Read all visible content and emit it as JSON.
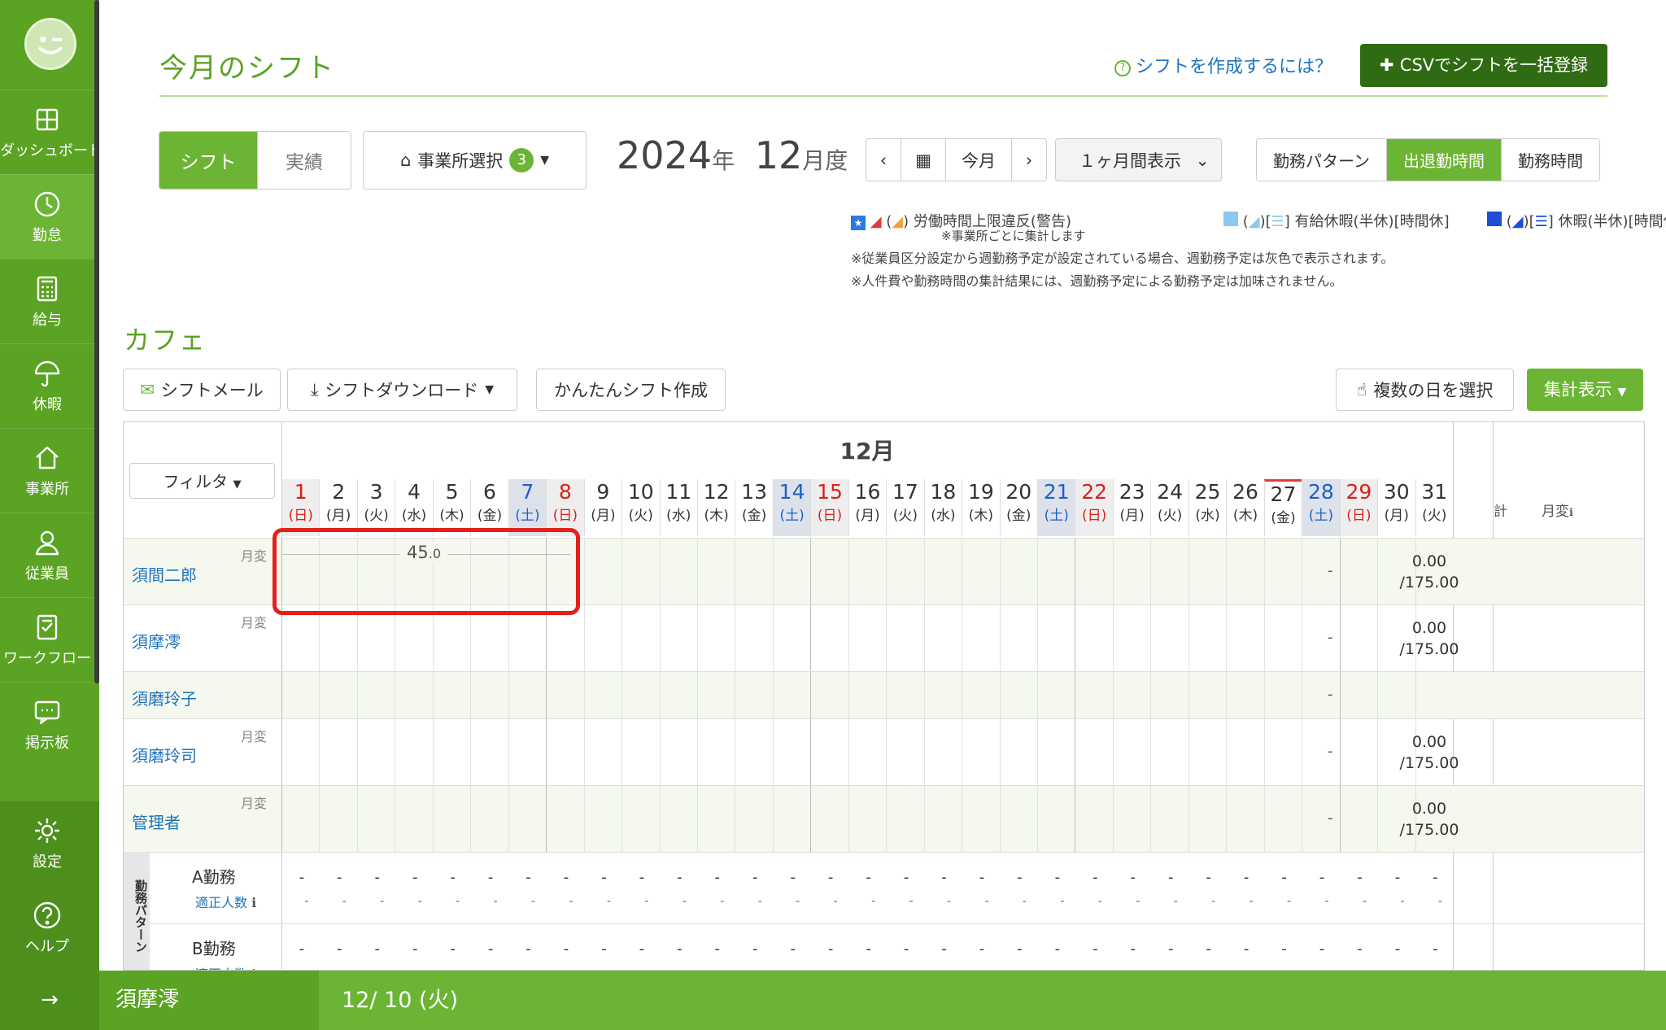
{
  "sidebar": {
    "items": [
      {
        "label": "ダッシュボード",
        "icon": "dashboard-icon"
      },
      {
        "label": "勤怠",
        "icon": "clock-icon",
        "active": true
      },
      {
        "label": "給与",
        "icon": "calculator-icon"
      },
      {
        "label": "休暇",
        "icon": "umbrella-icon"
      },
      {
        "label": "事業所",
        "icon": "home-icon"
      },
      {
        "label": "従業員",
        "icon": "person-icon"
      },
      {
        "label": "ワークフロー",
        "icon": "workflow-icon"
      },
      {
        "label": "掲示板",
        "icon": "chat-icon"
      }
    ],
    "bottom": [
      {
        "label": "設定",
        "icon": "gear-icon"
      },
      {
        "label": "ヘルプ",
        "icon": "help-icon"
      }
    ],
    "collapse": "→"
  },
  "header": {
    "title": "今月のシフト",
    "help_link": "シフトを作成するには？",
    "csv_button": "CSVでシフトを一括登録"
  },
  "toolbar": {
    "mode_shift": "シフト",
    "mode_actual": "実績",
    "office_select": "事業所選択",
    "office_count": "3",
    "year": "2024",
    "year_unit": "年",
    "month": "12",
    "month_unit": "月度",
    "today": "今月",
    "period": "１ヶ月間表示",
    "view_pattern": "勤務パターン",
    "view_inout": "出退勤時間",
    "view_hours": "勤務時間"
  },
  "legend": {
    "warn": "労働時間上限違反(警告)",
    "warn_sub": "※事業所ごとに集計します",
    "paid": "有給休暇(半休)[時間休]",
    "leave": "休暇(半休)[時間休]",
    "note1": "※従業員区分設定から週勤務予定が設定されている場合、週勤務予定は灰色で表示されます。",
    "note2": "※人件費や勤務時間の集計結果には、週勤務予定による勤務予定は加味されません。"
  },
  "section": {
    "title": "カフェ",
    "mail_btn": "シフトメール",
    "download_btn": "シフトダウンロード",
    "easy_btn": "かんたんシフト作成",
    "multi_btn": "複数の日を選択",
    "summary_btn": "集計表示"
  },
  "grid": {
    "month_label": "12月",
    "filter": "フィルタ",
    "total_header": "計",
    "monthly_header": "月変",
    "days": [
      {
        "n": "1",
        "w": "(日)",
        "t": "sun"
      },
      {
        "n": "2",
        "w": "(月)"
      },
      {
        "n": "3",
        "w": "(火)"
      },
      {
        "n": "4",
        "w": "(水)"
      },
      {
        "n": "5",
        "w": "(木)"
      },
      {
        "n": "6",
        "w": "(金)"
      },
      {
        "n": "7",
        "w": "(土)",
        "t": "sat"
      },
      {
        "n": "8",
        "w": "(日)",
        "t": "sun"
      },
      {
        "n": "9",
        "w": "(月)"
      },
      {
        "n": "10",
        "w": "(火)"
      },
      {
        "n": "11",
        "w": "(水)"
      },
      {
        "n": "12",
        "w": "(木)"
      },
      {
        "n": "13",
        "w": "(金)"
      },
      {
        "n": "14",
        "w": "(土)",
        "t": "sat"
      },
      {
        "n": "15",
        "w": "(日)",
        "t": "sun"
      },
      {
        "n": "16",
        "w": "(月)"
      },
      {
        "n": "17",
        "w": "(火)"
      },
      {
        "n": "18",
        "w": "(水)"
      },
      {
        "n": "19",
        "w": "(木)"
      },
      {
        "n": "20",
        "w": "(金)"
      },
      {
        "n": "21",
        "w": "(土)",
        "t": "sat"
      },
      {
        "n": "22",
        "w": "(日)",
        "t": "sun"
      },
      {
        "n": "23",
        "w": "(月)"
      },
      {
        "n": "24",
        "w": "(火)"
      },
      {
        "n": "25",
        "w": "(水)"
      },
      {
        "n": "26",
        "w": "(木)"
      },
      {
        "n": "27",
        "w": "(金)",
        "today": true
      },
      {
        "n": "28",
        "w": "(土)",
        "t": "sat"
      },
      {
        "n": "29",
        "w": "(日)",
        "t": "sun"
      },
      {
        "n": "30",
        "w": "(月)"
      },
      {
        "n": "31",
        "w": "(火)"
      }
    ],
    "employees": [
      {
        "name": "須間二郎",
        "tag": "月変",
        "total": "-",
        "monthly": "0.00",
        "limit": "/175.00",
        "alt": true
      },
      {
        "name": "須摩澪",
        "tag": "月変",
        "total": "-",
        "monthly": "0.00",
        "limit": "/175.00",
        "alt": false
      },
      {
        "name": "須磨玲子",
        "tag": "",
        "total": "-",
        "monthly": "",
        "limit": "",
        "alt": true
      },
      {
        "name": "須磨玲司",
        "tag": "月変",
        "total": "-",
        "monthly": "0.00",
        "limit": "/175.00",
        "alt": false
      },
      {
        "name": "管理者",
        "tag": "月変",
        "total": "-",
        "monthly": "0.00",
        "limit": "/175.00",
        "alt": true
      }
    ],
    "week_total_main": "45",
    "week_total_dec": ".0",
    "pattern_label": "勤務パターン",
    "patterns": [
      {
        "name": "A勤務",
        "sub": "適正人数"
      },
      {
        "name": "B勤務",
        "sub": "適正人数"
      }
    ],
    "cell_dash": "-"
  },
  "status": {
    "employee": "須摩澪",
    "date": "12/ 10 (火)"
  }
}
